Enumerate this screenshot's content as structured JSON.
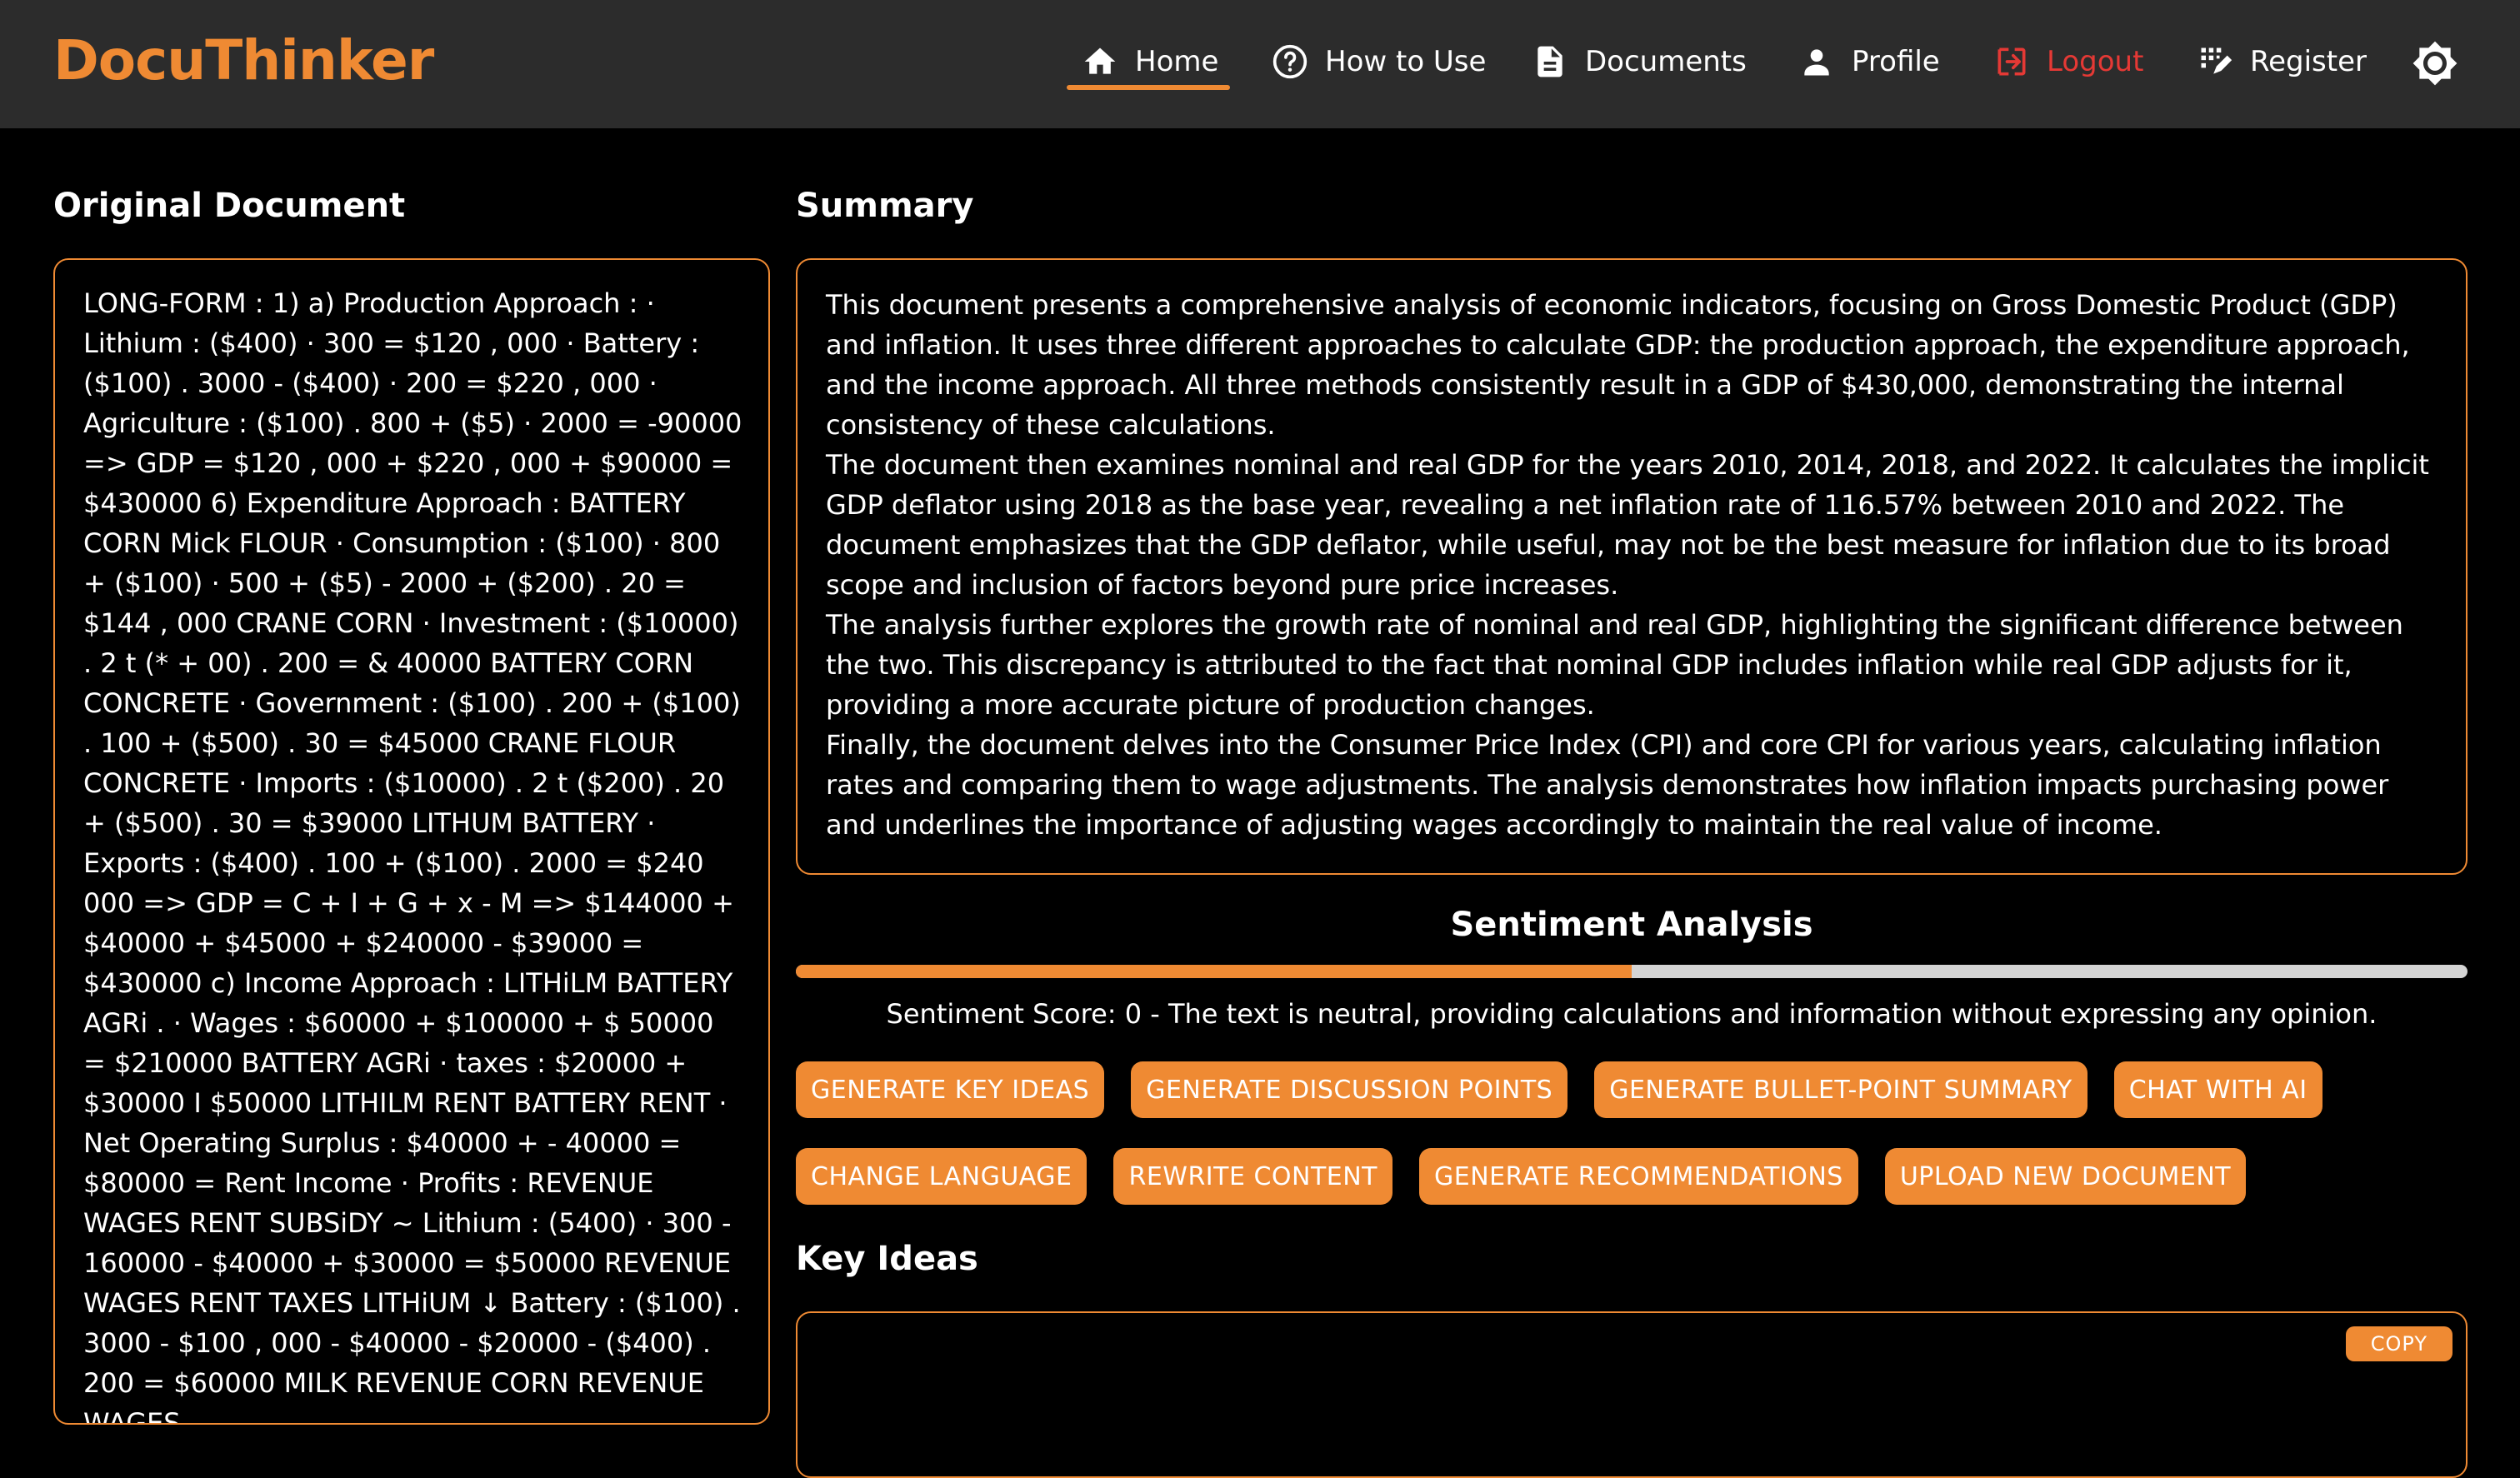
{
  "app": {
    "brand": "DocuThinker",
    "accent": "#ef8a33",
    "logout_color": "#e53935"
  },
  "nav": {
    "items": [
      {
        "label": "Home",
        "icon": "home-icon",
        "active": true
      },
      {
        "label": "How to Use",
        "icon": "help-circle-icon"
      },
      {
        "label": "Documents",
        "icon": "document-icon"
      },
      {
        "label": "Profile",
        "icon": "person-icon"
      },
      {
        "label": "Logout",
        "icon": "logout-icon"
      },
      {
        "label": "Register",
        "icon": "register-icon"
      }
    ],
    "theme_toggle_icon": "brightness-icon"
  },
  "original": {
    "title": "Original Document",
    "text": "LONG-FORM : 1) a) Production Approach : · Lithium : ($400) · 300 = $120 , 000 · Battery : ($100) . 3000 - ($400) · 200 = $220 , 000 · Agriculture : ($100) . 800 + ($5) · 2000 = -90000 => GDP = $120 , 000 + $220 , 000 + $90000 = $430000 6) Expenditure Approach : BATTERY CORN Mick FLOUR · Consumption : ($100) · 800 + ($100) · 500 + ($5) - 2000 + ($200) . 20 = $144 , 000 CRANE CORN · Investment : ($10000) . 2 t (* + 00) . 200 = & 40000 BATTERY CORN CONCRETE · Government : ($100) . 200 + ($100) . 100 + ($500) . 30 = $45000 CRANE FLOUR CONCRETE · Imports : ($10000) . 2 t ($200) . 20 + ($500) . 30 = $39000 LITHUM BATTERY · Exports : ($400) . 100 + ($100) . 2000 = $240 000 => GDP = C + I + G + x - M => $144000 + $40000 + $45000 + $240000 - $39000 = $430000 c) Income Approach : LITHiLM BATTERY AGRi . · Wages : $60000 + $100000 + $ 50000 = $210000 BATTERY AGRi · taxes : $20000 + $30000 I $50000 LITHILM RENT BATTERY RENT · Net Operating Surplus : $40000 + - 40000 = $80000 = Rent Income · Profits : REVENUE WAGES RENT SUBSiDY ~ Lithium : (5400) · 300 - 160000 - $40000 + $30000 = $50000 REVENUE WAGES RENT TAXES LITHiUM ↓ Battery : ($100) . 3000 - $100 , 000 - $40000 - $20000 - ($400) . 200 = $60000 MILK REVENUE CORN REVENUE WAGES"
  },
  "summary": {
    "title": "Summary",
    "paragraphs": [
      "This document presents a comprehensive analysis of economic indicators, focusing on Gross Domestic Product (GDP) and inflation. It uses three different approaches to calculate GDP: the production approach, the expenditure approach, and the income approach. All three methods consistently result in a GDP of $430,000, demonstrating the internal consistency of these calculations.",
      "The document then examines nominal and real GDP for the years 2010, 2014, 2018, and 2022. It calculates the implicit GDP deflator using 2018 as the base year, revealing a net inflation rate of 116.57% between 2010 and 2022. The document emphasizes that the GDP deflator, while useful, may not be the best measure for inflation due to its broad scope and inclusion of factors beyond pure price increases.",
      "The analysis further explores the growth rate of nominal and real GDP, highlighting the significant difference between the two. This discrepancy is attributed to the fact that nominal GDP includes inflation while real GDP adjusts for it, providing a more accurate picture of production changes.",
      "Finally, the document delves into the Consumer Price Index (CPI) and core CPI for various years, calculating inflation rates and comparing them to wage adjustments. The analysis demonstrates how inflation impacts purchasing power and underlines the importance of adjusting wages accordingly to maintain the real value of income."
    ]
  },
  "sentiment": {
    "title": "Sentiment Analysis",
    "fill_fraction": 0.5,
    "score_text": "Sentiment Score: 0 - The text is neutral, providing calculations and information without expressing any opinion."
  },
  "actions": [
    "GENERATE KEY IDEAS",
    "GENERATE DISCUSSION POINTS",
    "GENERATE BULLET-POINT SUMMARY",
    "CHAT WITH AI",
    "CHANGE LANGUAGE",
    "REWRITE CONTENT",
    "GENERATE RECOMMENDATIONS",
    "UPLOAD NEW DOCUMENT"
  ],
  "key_ideas": {
    "title": "Key Ideas",
    "copy_label": "COPY"
  }
}
